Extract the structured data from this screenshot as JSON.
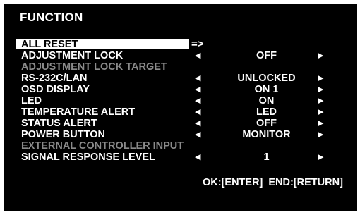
{
  "menu": {
    "title": "FUNCTION",
    "enter_arrow": "=>",
    "arrow_left": "◀",
    "arrow_right": "▶",
    "items": [
      {
        "label": "ALL RESET",
        "value": ""
      },
      {
        "label": "ADJUSTMENT LOCK",
        "value": "OFF"
      },
      {
        "label": "ADJUSTMENT LOCK TARGET",
        "value": ""
      },
      {
        "label": "RS-232C/LAN",
        "value": "UNLOCKED"
      },
      {
        "label": "OSD DISPLAY",
        "value": "ON 1"
      },
      {
        "label": "LED",
        "value": "ON"
      },
      {
        "label": "TEMPERATURE ALERT",
        "value": "LED"
      },
      {
        "label": "STATUS ALERT",
        "value": "OFF"
      },
      {
        "label": "POWER BUTTON",
        "value": "MONITOR"
      },
      {
        "label": "EXTERNAL CONTROLLER INPUT",
        "value": ""
      },
      {
        "label": "SIGNAL RESPONSE LEVEL",
        "value": "1"
      }
    ]
  },
  "footer": {
    "ok_label": "OK:[ENTER]",
    "end_label": "END:[RETURN]"
  }
}
